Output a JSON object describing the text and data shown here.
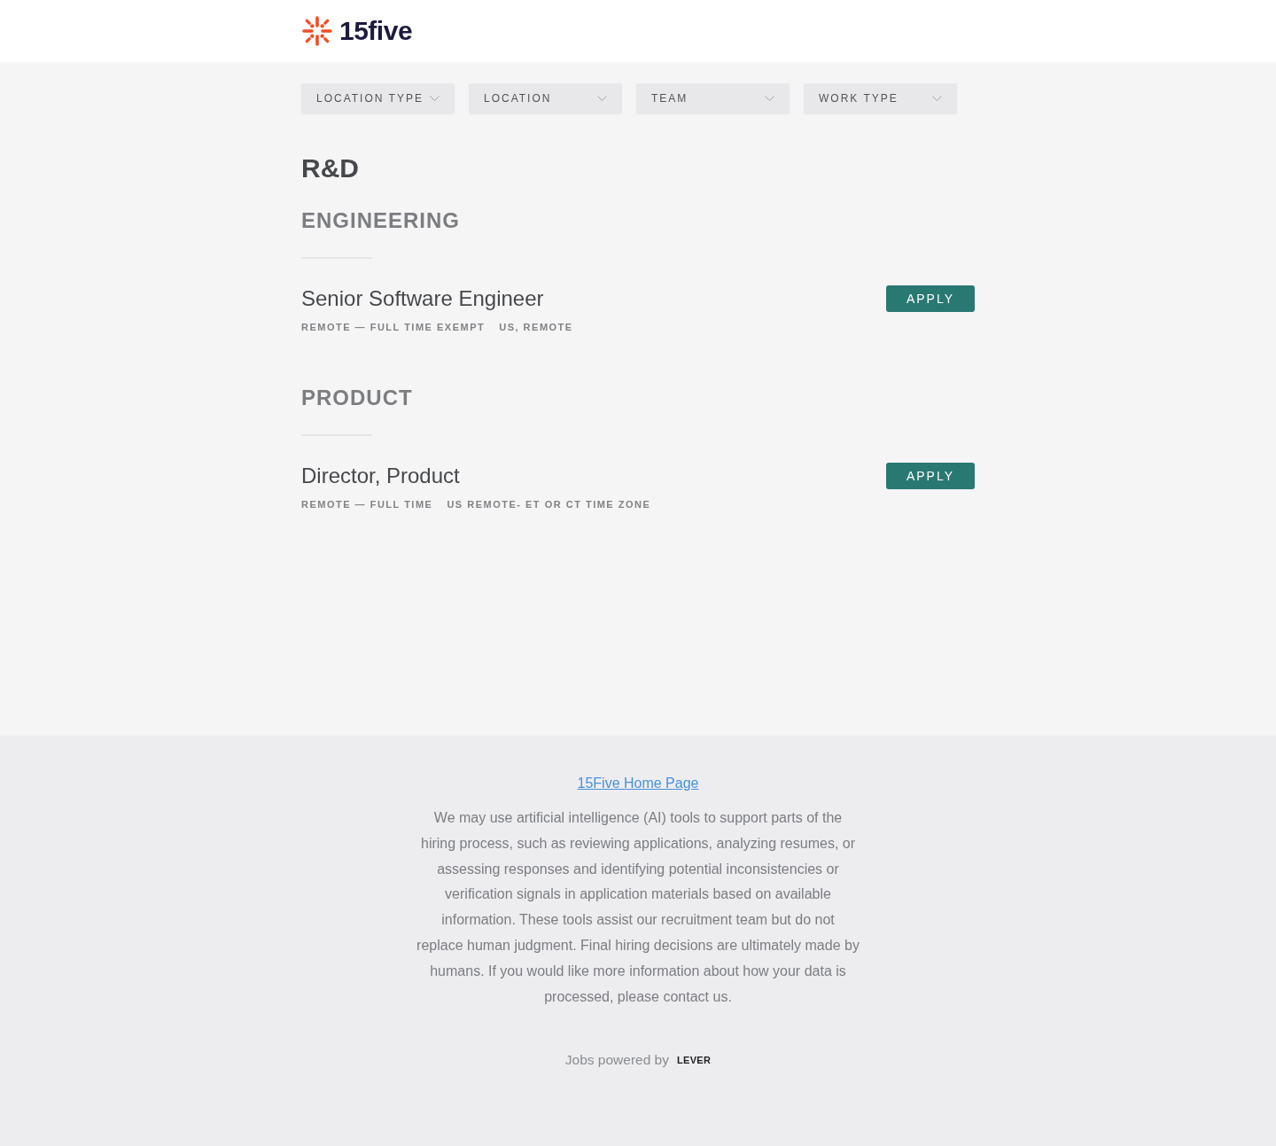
{
  "header": {
    "logo_text": "15five"
  },
  "filters": [
    {
      "label": "LOCATION TYPE"
    },
    {
      "label": "LOCATION"
    },
    {
      "label": "TEAM"
    },
    {
      "label": "WORK TYPE"
    }
  ],
  "department": {
    "title": "R&D",
    "teams": [
      {
        "title": "ENGINEERING",
        "postings": [
          {
            "title": "Senior Software Engineer",
            "commitment": "REMOTE — FULL TIME EXEMPT",
            "location": "US, REMOTE",
            "button": "APPLY"
          }
        ]
      },
      {
        "title": "PRODUCT",
        "postings": [
          {
            "title": "Director, Product",
            "commitment": "REMOTE — FULL TIME",
            "location": "US REMOTE- ET OR CT TIME ZONE",
            "button": "APPLY"
          }
        ]
      }
    ]
  },
  "footer": {
    "link": "15Five Home Page",
    "notice": "We may use artificial intelligence (AI) tools to support parts of the hiring process, such as reviewing applications, analyzing resumes, or assessing responses and identifying potential inconsistencies or verification signals in application materials based on available information. These tools assist our recruitment team but do not replace human judgment. Final hiring decisions are ultimately made by humans. If you would like more information about how your data is processed, please contact us.",
    "powered_by": "Jobs powered by",
    "brand": "LEVER"
  }
}
